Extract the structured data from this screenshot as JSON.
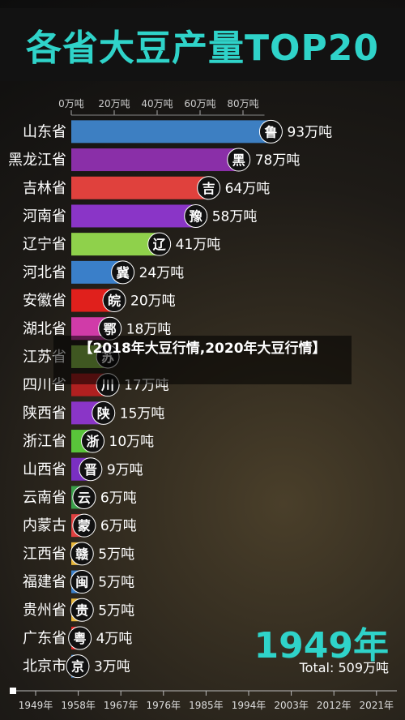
{
  "title": "各省大豆产量TOP20",
  "caption": "【2018年大豆行情,2020年大豆行情】",
  "year_label": "1949年",
  "total_label": "Total: 509万吨",
  "chart_data": {
    "type": "bar",
    "orientation": "horizontal",
    "top_axis_ticks": [
      "0万吨",
      "20万吨",
      "40万吨",
      "60万吨",
      "80万吨"
    ],
    "top_axis_values": [
      0,
      20,
      40,
      60,
      80
    ],
    "bottom_axis_ticks": [
      "1949年",
      "1958年",
      "1967年",
      "1976年",
      "1985年",
      "1994年",
      "2003年",
      "2012年",
      "2021年"
    ],
    "categories": [
      "山东省",
      "黑龙江省",
      "吉林省",
      "河南省",
      "辽宁省",
      "河北省",
      "安徽省",
      "湖北省",
      "江苏省",
      "四川省",
      "陕西省",
      "浙江省",
      "山西省",
      "云南省",
      "内蒙古",
      "江西省",
      "福建省",
      "贵州省",
      "广东省",
      "北京市"
    ],
    "category_abbrev": [
      "鲁",
      "黑",
      "吉",
      "豫",
      "辽",
      "冀",
      "皖",
      "鄂",
      "苏",
      "川",
      "陕",
      "浙",
      "晋",
      "云",
      "蒙",
      "赣",
      "闽",
      "贵",
      "粤",
      "京"
    ],
    "values": [
      93,
      78,
      64,
      58,
      41,
      24,
      20,
      18,
      17,
      17,
      15,
      10,
      9,
      6,
      6,
      5,
      5,
      5,
      4,
      3
    ],
    "value_labels": [
      "93万吨",
      "78万吨",
      "64万吨",
      "58万吨",
      "41万吨",
      "24万吨",
      "20万吨",
      "18万吨",
      "",
      "17万吨",
      "15万吨",
      "10万吨",
      "9万吨",
      "6万吨",
      "6万吨",
      "5万吨",
      "5万吨",
      "5万吨",
      "4万吨",
      "3万吨"
    ],
    "colors": [
      "#3d7fc2",
      "#8a2fa8",
      "#e0413d",
      "#8a35c7",
      "#8fd14b",
      "#3a7fc9",
      "#e0201c",
      "#d03ba8",
      "#8cc24a",
      "#b02020",
      "#8a35c7",
      "#59c43a",
      "#7a2fc2",
      "#3aa04a",
      "#e04040",
      "#e8b73a",
      "#3a7fc9",
      "#e8b73a",
      "#e02020",
      "#3a7fc9"
    ]
  }
}
